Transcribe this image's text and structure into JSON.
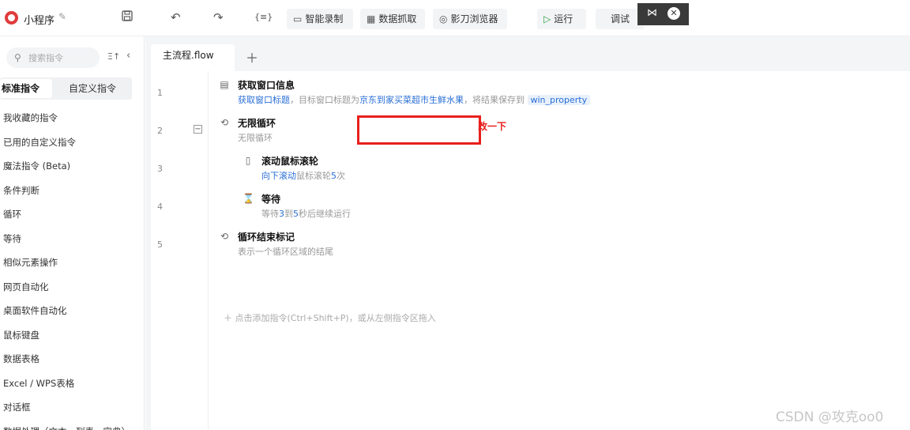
{
  "app": {
    "title": "小程序"
  },
  "toolbar": {
    "smart_record": "智能录制",
    "data_capture": "数据抓取",
    "browser": "影刀浏览器",
    "run": "运行",
    "debug": "调试",
    "variable_glyph": "{≡}"
  },
  "sidebar": {
    "search_placeholder": "搜索指令",
    "tabs": [
      "标准指令",
      "自定义指令"
    ],
    "categories": [
      "我收藏的指令",
      "已用的自定义指令",
      "魔法指令 (Beta)",
      "条件判断",
      "循环",
      "等待",
      "相似元素操作",
      "网页自动化",
      "桌面软件自动化",
      "鼠标键盘",
      "数据表格",
      "Excel / WPS表格",
      "对话框",
      "数据处理（文本、列表、字典）"
    ]
  },
  "editor": {
    "tab_name": "主流程.flow",
    "line_numbers": [
      "1",
      "2",
      "3",
      "4",
      "5"
    ],
    "commands": [
      {
        "title": "获取窗口信息",
        "desc_link": "获取窗口标题",
        "desc_mid": "，目标窗口标题为",
        "desc_value": "京东到家买菜超市生鲜水果",
        "desc_tail": "，将结果保存到",
        "desc_var": "win_property"
      },
      {
        "title": "无限循环",
        "desc": "无限循环"
      },
      {
        "title": "滚动鼠标滚轮",
        "desc_link": "向下滚动",
        "desc_mid": "鼠标滚轮",
        "desc_num": "5",
        "desc_tail": "次"
      },
      {
        "title": "等待",
        "desc_pre": "等待",
        "desc_a": "3",
        "desc_mid": "到",
        "desc_b": "5",
        "desc_tail": "秒后继续运行"
      },
      {
        "title": "循环结束标记",
        "desc": "表示一个循环区域的结尾"
      }
    ],
    "add_hint": "点击添加指令(Ctrl+Shift+P)，或从左侧指令区拖入"
  },
  "annotation": {
    "note": "改一下"
  },
  "watermark": "CSDN @攻克oo0",
  "colors": {
    "link": "#2a6fd6",
    "highlight": "#e8201c",
    "run": "#2ea043"
  }
}
